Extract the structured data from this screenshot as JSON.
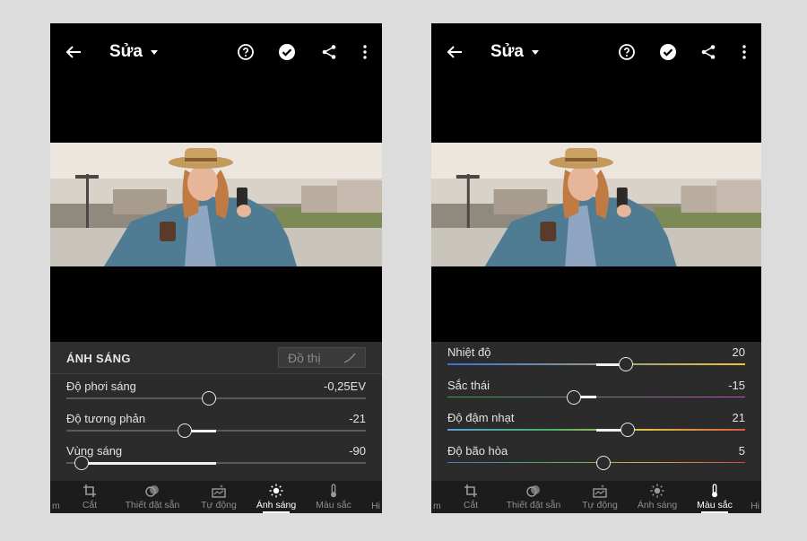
{
  "left_screen": {
    "header": {
      "title": "Sửa"
    },
    "panel": {
      "section_title": "ÁNH SÁNG",
      "graph_label": "Đồ thị",
      "sliders": [
        {
          "label": "Độ phơi sáng",
          "value": "-0,25EV",
          "position": 0.475
        },
        {
          "label": "Độ tương phản",
          "value": "-21",
          "position": 0.395
        },
        {
          "label": "Vùng sáng",
          "value": "-90",
          "position": 0.05
        }
      ]
    },
    "tabs": {
      "edge_left": "m",
      "edge_right": "Hi",
      "items": [
        {
          "label": "Cắt",
          "icon": "crop-icon"
        },
        {
          "label": "Thiết đặt sẵn",
          "icon": "presets-icon"
        },
        {
          "label": "Tự động",
          "icon": "auto-icon"
        },
        {
          "label": "Ánh sáng",
          "icon": "sun-icon",
          "active": true
        },
        {
          "label": "Màu sắc",
          "icon": "thermometer-icon"
        }
      ]
    }
  },
  "right_screen": {
    "header": {
      "title": "Sửa"
    },
    "panel": {
      "sliders": [
        {
          "label": "Nhiệt độ",
          "value": "20",
          "position": 0.6,
          "track": "temperature"
        },
        {
          "label": "Sắc thái",
          "value": "-15",
          "position": 0.425,
          "track": "tint"
        },
        {
          "label": "Độ đậm nhạt",
          "value": "21",
          "position": 0.605,
          "track": "vibrance"
        },
        {
          "label": "Độ bão hòa",
          "value": "5",
          "position": 0.525,
          "track": "saturation"
        }
      ]
    },
    "tabs": {
      "edge_left": "m",
      "edge_right": "Hi",
      "items": [
        {
          "label": "Cắt",
          "icon": "crop-icon"
        },
        {
          "label": "Thiết đặt sẵn",
          "icon": "presets-icon"
        },
        {
          "label": "Tự động",
          "icon": "auto-icon"
        },
        {
          "label": "Ánh sáng",
          "icon": "sun-icon"
        },
        {
          "label": "Màu sắc",
          "icon": "thermometer-icon",
          "active": true
        }
      ]
    }
  },
  "colors": {
    "background": "#dcdcdc",
    "panel": "#2b2b2b",
    "temperature_track": [
      "#3b6fd8",
      "#e8c53a"
    ],
    "tint_track": [
      "#3ca64a",
      "#c04fc0"
    ],
    "vibrance_track": [
      "#5aa0d8",
      "#46b06a",
      "#e0c04a",
      "#d85a3a"
    ],
    "saturation_track": [
      "#3f7ad0",
      "#53b060",
      "#e0b040",
      "#d44a3a"
    ]
  }
}
